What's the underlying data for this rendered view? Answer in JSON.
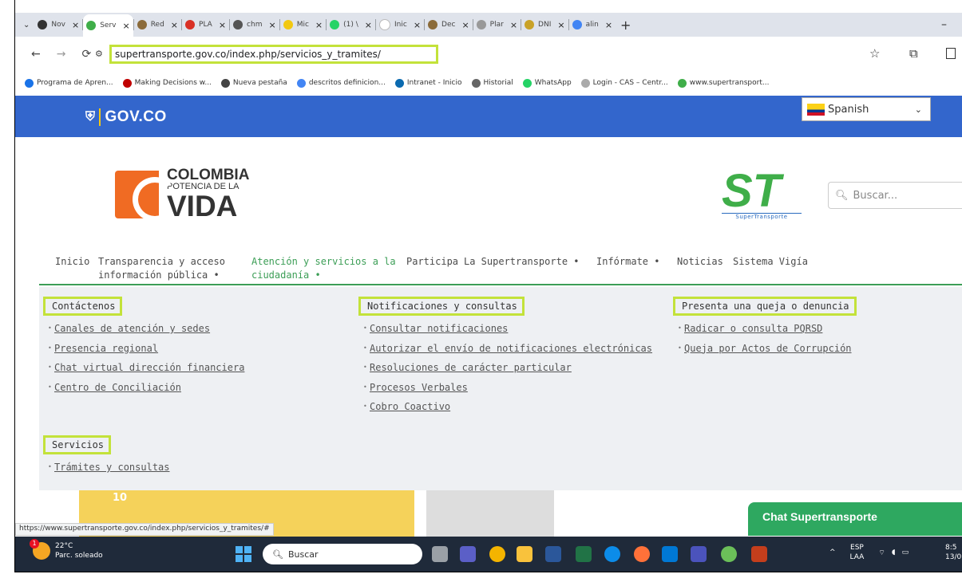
{
  "browser": {
    "tabs": [
      {
        "label": "Nov",
        "icon": "globe-icon",
        "color": "#333333"
      },
      {
        "label": "Serv",
        "icon": "supertransporte-icon",
        "color": "#3fae49",
        "active": true
      },
      {
        "label": "Red",
        "icon": "shield-icon",
        "color": "#8b6b3a"
      },
      {
        "label": "PLA",
        "icon": "pdf-icon",
        "color": "#d93025"
      },
      {
        "label": "chm",
        "icon": "pdf-icon",
        "color": "#555555"
      },
      {
        "label": "Mic",
        "icon": "powerbi-icon",
        "color": "#f2c811"
      },
      {
        "label": "(1) \\",
        "icon": "whatsapp-icon",
        "color": "#25d366"
      },
      {
        "label": "Inic",
        "icon": "blank-page-icon",
        "color": "#ffffff"
      },
      {
        "label": "Dec",
        "icon": "shield-icon",
        "color": "#8b6b3a"
      },
      {
        "label": "Plar",
        "icon": "shield-icon",
        "color": "#999999"
      },
      {
        "label": "DNI",
        "icon": "building-icon",
        "color": "#c9a227"
      },
      {
        "label": "alin",
        "icon": "google-icon",
        "color": "#4285f4"
      }
    ],
    "url": "supertransporte.gov.co/index.php/servicios_y_tramites/",
    "bookmarks": [
      {
        "label": "Programa de Apren...",
        "color": "#1a73e8"
      },
      {
        "label": "Making Decisions w...",
        "color": "#c00000"
      },
      {
        "label": "Nueva pestaña",
        "color": "#444444"
      },
      {
        "label": "descritos definicion...",
        "color": "#4285f4"
      },
      {
        "label": "Intranet - Inicio",
        "color": "#0b6ab0"
      },
      {
        "label": "Historial",
        "color": "#666666"
      },
      {
        "label": "WhatsApp",
        "color": "#25d366"
      },
      {
        "label": "Login - CAS – Centr...",
        "color": "#aaaaaa"
      },
      {
        "label": "www.supertransport...",
        "color": "#3fae49"
      }
    ],
    "status_url": "https://www.supertransporte.gov.co/index.php/servicios_y_tramites/#"
  },
  "gov": {
    "logo": "GOV.CO",
    "language": "Spanish"
  },
  "site": {
    "colombia_logo": {
      "line1": "COLOMBIA",
      "line2": "POTENCIA DE LA",
      "line3": "VIDA"
    },
    "st_logo": {
      "letters": "ST",
      "sub": "SuperTransporte"
    },
    "search_placeholder": "Buscar...",
    "nav": [
      {
        "line1": "Inicio",
        "line2": ""
      },
      {
        "line1": "Transparencia y acceso",
        "line2": "información pública •"
      },
      {
        "line1": "Atención y servicios a la",
        "line2": "ciudadanía •"
      },
      {
        "line1": "Participa",
        "line2": ""
      },
      {
        "line1": "La Supertransporte •",
        "line2": ""
      },
      {
        "line1": "Infórmate •",
        "line2": ""
      },
      {
        "line1": "Noticias",
        "line2": ""
      },
      {
        "line1": "Sistema Vigía",
        "line2": ""
      }
    ],
    "menu": {
      "contactenos": {
        "title": "Contáctenos",
        "links": [
          "Canales de atención y sedes",
          "Presencia regional",
          "Chat virtual dirección financiera",
          "Centro de Conciliación"
        ]
      },
      "notificaciones": {
        "title": "Notificaciones y consultas",
        "links": [
          "Consultar notificaciones",
          "Autorizar el envío de notificaciones electrónicas",
          "Resoluciones de carácter particular",
          "Procesos Verbales",
          "Cobro Coactivo"
        ]
      },
      "queja": {
        "title": "Presenta una queja o denuncia",
        "links": [
          "Radicar o consulta PQRSD",
          "Queja por Actos de Corrupción"
        ]
      },
      "servicios": {
        "title": "Servicios",
        "links": [
          "Trámites y consultas"
        ]
      }
    },
    "behind_badge": "10",
    "chat_label": "Chat Supertransporte"
  },
  "taskbar": {
    "weather_temp": "22°C",
    "weather_desc": "Parc. soleado",
    "weather_badge": "1",
    "search_label": "Buscar",
    "lang_top": "ESP",
    "lang_bottom": "LAA",
    "time": "8:5",
    "date": "13/0"
  }
}
